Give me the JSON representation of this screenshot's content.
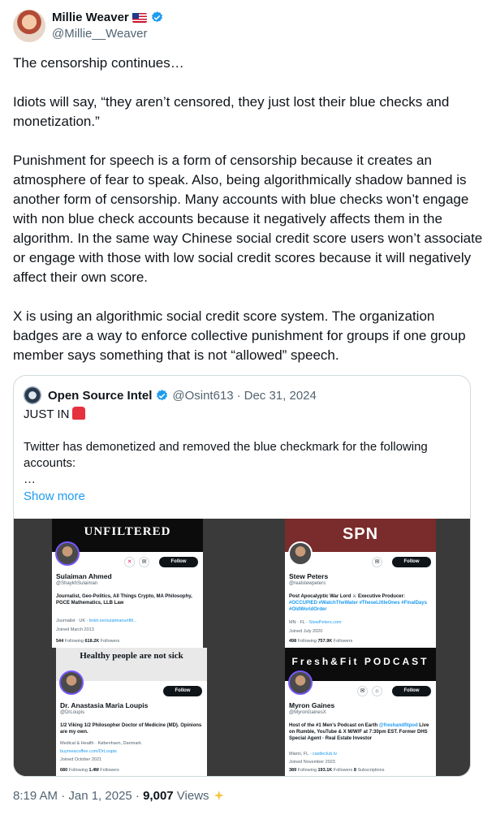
{
  "author": {
    "display_name": "Millie Weaver",
    "handle": "@Millie__Weaver",
    "flag_icon": "us-flag-icon",
    "verified_color": "#1d9bf0"
  },
  "tweet": {
    "text": "The censorship continues…\n\nIdiots will say, “they aren’t censored, they just lost their blue checks and monetization.”\n\nPunishment for speech is a form of censorship because it creates an atmosphere of fear to speak. Also, being algorithmically shadow banned is another form of censorship. Many accounts with blue checks won’t engage with non blue check accounts because it negatively affects them in the algorithm. In the same way Chinese social credit score users won’t associate or engage with those with low social credit scores because it will negatively affect their own score.\n\nX is using an algorithmic social credit score system. The organization badges are a way to enforce collective punishment for groups if one group member says something that is not “allowed” speech."
  },
  "quote": {
    "display_name": "Open Source Intel",
    "handle": "@Osint613",
    "separator": "·",
    "date": "Dec 31, 2024",
    "headline": "JUST IN",
    "body": "Twitter has demonetized and removed the blue checkmark for the following accounts:\n…",
    "show_more": "Show more"
  },
  "profiles": [
    {
      "banner_text": "UNFILTERED",
      "name": "Sulaiman Ahmed",
      "handle": "@ShaykhSulaiman",
      "bio": "Journalist, Geo-Politics, All Things Crypto, MA Philosophy, PGCE Mathematics, LLB Law",
      "meta1": "Journalist · UK · ",
      "link": "linktr.ee/sulaimanunfilt...",
      "meta2": "Joined March 2013",
      "following": "544",
      "following_label": "Following",
      "followers": "618.2K",
      "followers_label": "Followers",
      "follow_label": "Follow"
    },
    {
      "banner_text": "SPN",
      "name": "Stew Peters",
      "handle": "@realstewpeters",
      "bio": "Post Apocalyptic War Lord ⚔ Executive Producer: ",
      "bio_tags": "#OCCUPIED #WatchTheWater #TheseLittleOnes #FinalDays #OldWorldOrder",
      "meta1": "MN · FL · ",
      "link": "StewPeters.com",
      "meta2": "Joined July 2020",
      "following": "498",
      "following_label": "Following",
      "followers": "757.9K",
      "followers_label": "Followers",
      "follow_label": "Follow"
    },
    {
      "banner_text": "Healthy people are not sick",
      "name": "Dr. Anastasia Maria Loupis",
      "handle": "@DrLoupis",
      "bio": "1/2 Viking 1/2 Philosopher Doctor of Medicine (MD). Opinions are my own.",
      "meta1": "Medical & Health · København, Danmark",
      "link": "buymeacoffee.com/DrLoupis",
      "meta2": "Joined October 2021",
      "following": "680",
      "following_label": "Following",
      "followers": "1.4M",
      "followers_label": "Followers",
      "follow_label": "Follow"
    },
    {
      "banner_text": "Fresh&Fit PODCAST",
      "name": "Myron Gaines",
      "handle": "@MyronGainesX",
      "bio": "Host of the #1 Men's Podcast on Earth ",
      "bio_tags": "@freshandfitpod",
      "bio_rest": " Live on Rumble, YouTube & X M/W/F at 7:30pm EST. Former DHS Special Agent · Real Estate Investor",
      "meta1": "Miami, FL · ",
      "link": "castleclub.tv",
      "meta2": "Joined November 2023",
      "following": "389",
      "following_label": "Following",
      "followers": "193.1K",
      "followers_label": "Followers",
      "subscriptions": "8",
      "subscriptions_label": "Subscriptions",
      "follow_label": "Follow"
    }
  ],
  "footer": {
    "time_date": "8:19 AM · Jan 1, 2025 · ",
    "views": "9,007",
    "views_label": " Views",
    "analytics_icon": "sparkle-icon"
  }
}
